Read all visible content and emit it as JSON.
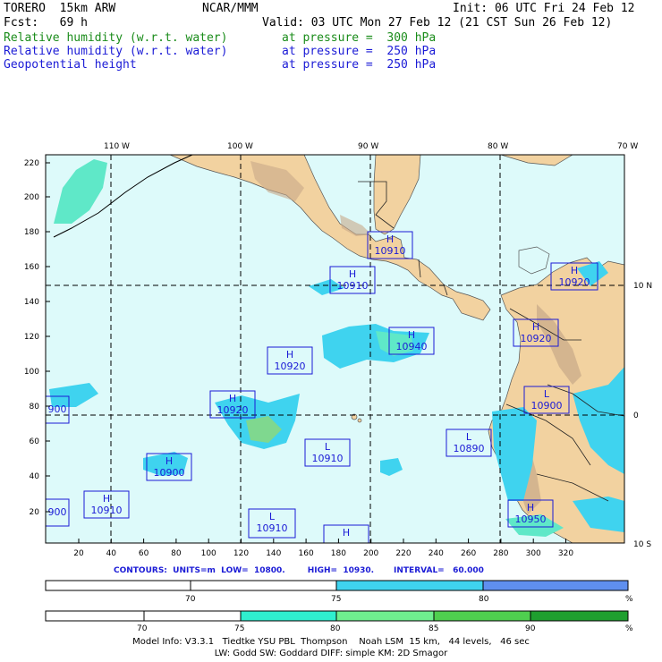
{
  "header": {
    "model": "TORERO  15km ARW",
    "org": "NCAR/MMM",
    "init": "Init: 06 UTC Fri 24 Feb 12",
    "fcst": "Fcst:   69 h",
    "valid": "Valid: 03 UTC Mon 27 Feb 12 (21 CST Sun 26 Feb 12)",
    "fields": [
      {
        "name": "Relative humidity (w.r.t. water)",
        "level": "at pressure =  300 hPa",
        "color": "#1a8c1a"
      },
      {
        "name": "Relative humidity (w.r.t. water)",
        "level": "at pressure =  250 hPa",
        "color": "#1b1bd6"
      },
      {
        "name": "Geopotential height",
        "level": "at pressure =  250 hPa",
        "color": "#1b1bd6"
      }
    ]
  },
  "map": {
    "lon_labels": [
      "110 W",
      "100 W",
      "90 W",
      "80 W",
      "70 W"
    ],
    "lat_labels": [
      "10 N",
      "0",
      "10 S"
    ],
    "left_ticks": [
      "220",
      "200",
      "180",
      "160",
      "140",
      "120",
      "100",
      "80",
      "60",
      "40",
      "20"
    ],
    "bottom_ticks": [
      "20",
      "40",
      "60",
      "80",
      "100",
      "120",
      "140",
      "160",
      "180",
      "200",
      "220",
      "240",
      "260",
      "280",
      "300",
      "320"
    ],
    "highs_lows": [
      {
        "type": "H",
        "value": "10910"
      },
      {
        "type": "H",
        "value": "10910"
      },
      {
        "type": "H",
        "value": "10920"
      },
      {
        "type": "H",
        "value": "10920"
      },
      {
        "type": "H",
        "value": "10940"
      },
      {
        "type": "H",
        "value": "10920"
      },
      {
        "type": "H",
        "value": "10920"
      },
      {
        "type": "L",
        "value": "10900"
      },
      {
        "type": "L",
        "value": "10890"
      },
      {
        "type": "L",
        "value": "10910"
      },
      {
        "type": "H",
        "value": "10900"
      },
      {
        "type": "H",
        "value": "10910"
      },
      {
        "type": "L",
        "value": "10910"
      },
      {
        "type": "H",
        "value": "10950"
      },
      {
        "type": "H",
        "value": ""
      },
      {
        "type": "",
        "value": "900"
      },
      {
        "type": "",
        "value": "900"
      }
    ]
  },
  "contours": {
    "text": "CONTOURS:  UNITS=m  LOW=  10800.        HIGH=  10930.       INTERVAL=   60.000"
  },
  "legend1": {
    "labels": [
      "70",
      "75",
      "80"
    ],
    "unit": "%",
    "colors": [
      "#ffffff",
      "#3fd3ef",
      "#5f8fef"
    ]
  },
  "legend2": {
    "labels": [
      "70",
      "75",
      "80",
      "85",
      "90"
    ],
    "unit": "%",
    "colors": [
      "#ffffff",
      "#ffffff",
      "#2fefcf",
      "#6fef8f",
      "#4fcf4f",
      "#1f9f2f"
    ]
  },
  "footer": {
    "line1": "Model Info: V3.3.1   Tiedtke YSU PBL  Thompson    Noah LSM  15 km,   44 levels,   46 sec",
    "line2": "LW: Godd SW: Goddard DIFF: simple KM: 2D Smagor"
  }
}
